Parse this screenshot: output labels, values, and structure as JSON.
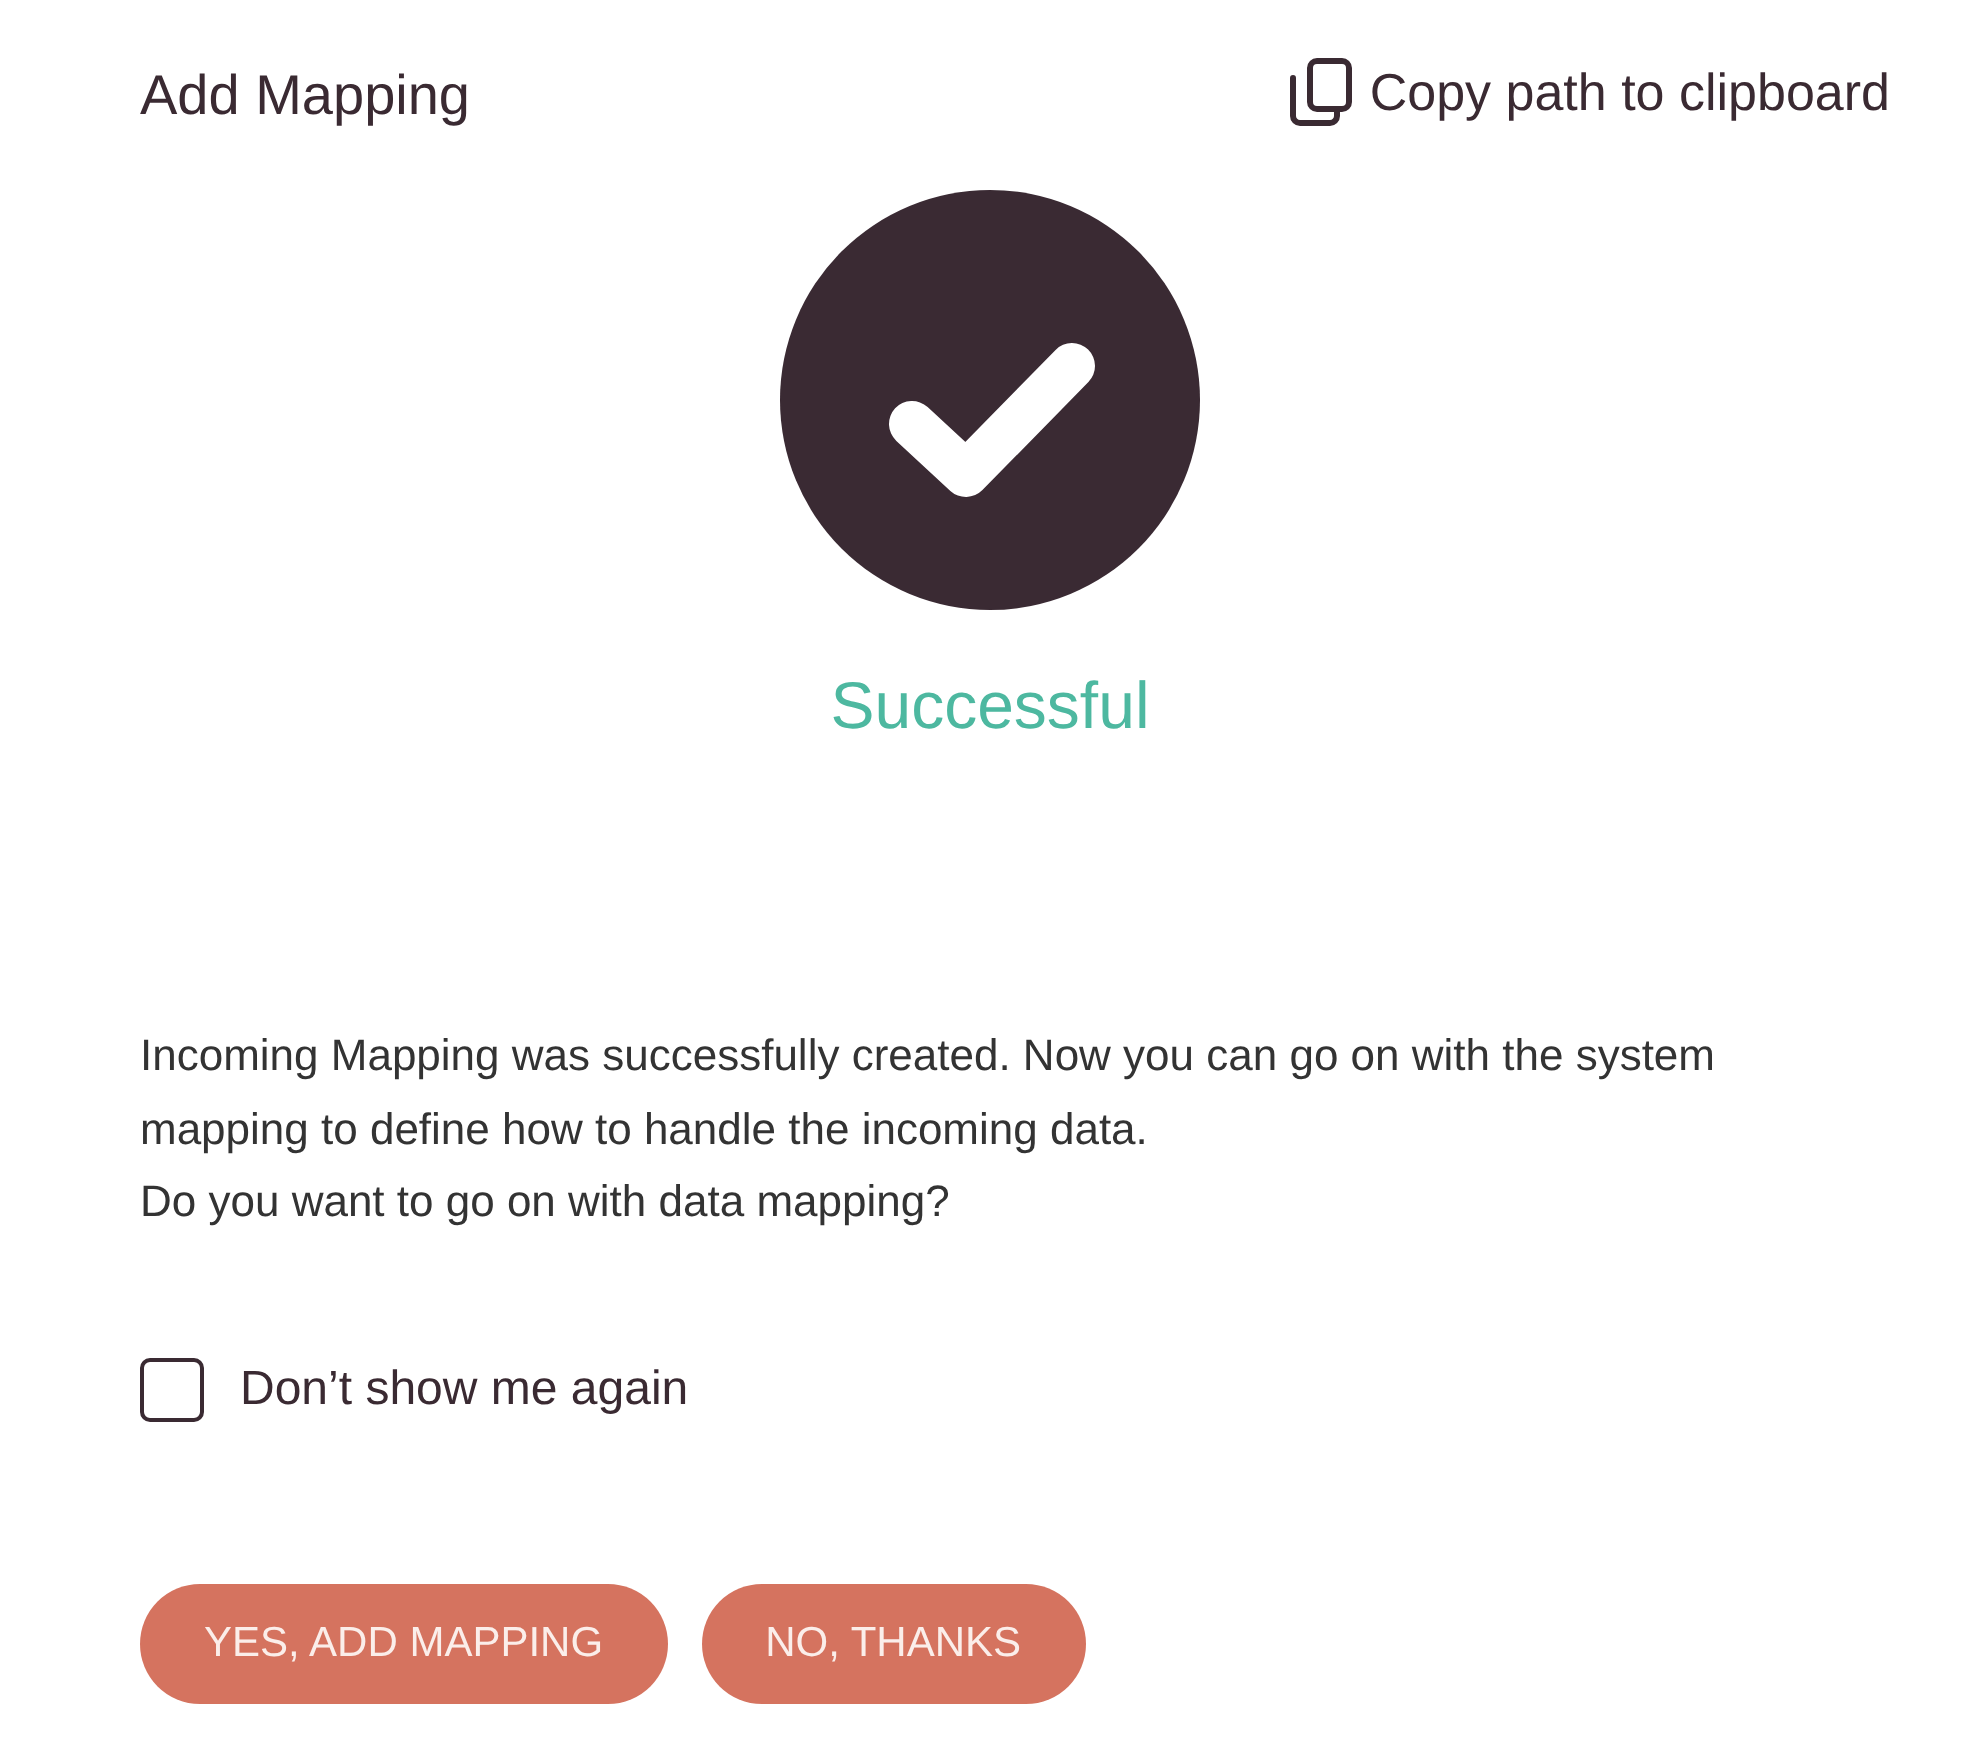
{
  "dialog": {
    "title": "Add Mapping",
    "copy_link": {
      "label": "Copy path to clipboard"
    }
  },
  "status": {
    "kind": "success",
    "label": "Successful"
  },
  "message": [
    "Incoming Mapping was successfully created. Now you can go on with the system mapping to define how to handle the incoming data.",
    "Do you want to go on with data mapping?"
  ],
  "checkbox": {
    "label": "Don’t show me again",
    "checked": false
  },
  "buttons": [
    {
      "label": "YES, ADD MAPPING"
    },
    {
      "label": "NO, THANKS"
    }
  ]
}
